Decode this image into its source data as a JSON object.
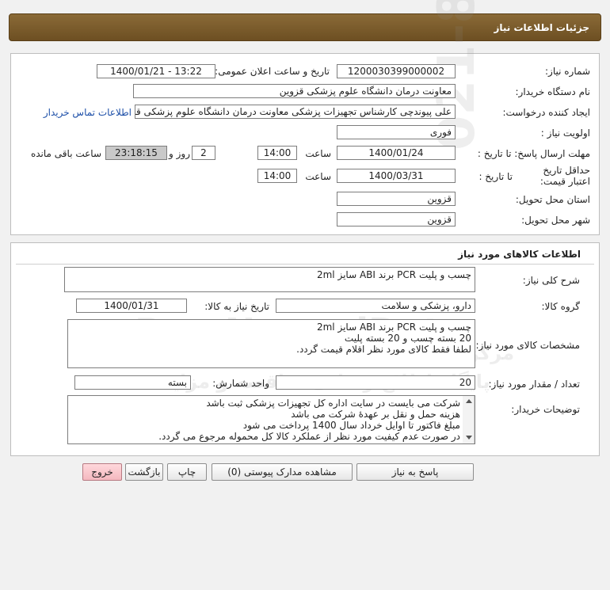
{
  "header": {
    "title": "جزئیات اطلاعات نیاز"
  },
  "info": {
    "need_number_label": "شماره نیاز:",
    "need_number": "1200030399000002",
    "announce_label": "تاریخ و ساعت اعلان عمومی:",
    "announce_value": "1400/01/21 - 13:22",
    "buyer_label": "نام دستگاه خریدار:",
    "buyer": "معاونت درمان دانشگاه علوم پزشکی قزوین",
    "creator_label": "ایجاد کننده درخواست:",
    "creator": "علی پیوندچی کارشناس تجهیزات پزشکی معاونت درمان دانشگاه علوم پزشکی قزوین",
    "contact_link": "اطلاعات تماس خریدار",
    "priority_label": "اولویت نیاز :",
    "priority": "فوری",
    "deadline_label": "مهلت ارسال پاسخ: تا تاریخ :",
    "deadline_date": "1400/01/24",
    "time_label": "ساعت",
    "deadline_time": "14:00",
    "days": "2",
    "days_label": "روز و",
    "remaining_timer": "23:18:15",
    "remaining_label": "ساعت باقی مانده",
    "validity_label": "حداقل تاریخ اعتبار قیمت:",
    "validity_until_label": "تا تاریخ :",
    "validity_date": "1400/03/31",
    "validity_time_label": "ساعت",
    "validity_time": "14:00",
    "province_label": "استان محل تحویل:",
    "province": "قزوین",
    "city_label": "شهر محل تحویل:",
    "city": "قزوین"
  },
  "goods": {
    "section_title": "اطلاعات کالاهای مورد نیاز",
    "summary_label": "شرح کلی نیاز:",
    "summary": "چسب و پلیت PCR برند ABI سایز 2ml",
    "group_label": "گروه کالا:",
    "group": "دارو، پزشکی و سلامت",
    "need_date_label": "تاریخ نیاز به کالا:",
    "need_date": "1400/01/31",
    "specs_label": "مشخصات کالای مورد نیاز:",
    "specs_lines": [
      "چسب و پلیت PCR برند ABI سایز 2ml",
      "20 بسته چسب و 20 بسته پلیت",
      "لطفا فقط کالای مورد نظر اقلام قیمت گردد."
    ],
    "qty_label": "تعداد / مقدار مورد نیاز:",
    "qty": "20",
    "unit_label": "واحد شمارش:",
    "unit": "بسته",
    "notes_label": "توضیحات خریدار:",
    "notes_lines": [
      "شرکت می بایست در سایت اداره کل تجهیزات پزشکی ثبت باشد",
      "هزینه حمل و نقل بر عهدهٔ شرکت می باشد",
      "مبلغ فاکتور تا اوایل خرداد سال 1400 پرداخت می شود",
      "در صورت عدم کیفیت مورد نظر از عملکرد کالا کل محموله مرجوع می گردد."
    ]
  },
  "buttons": {
    "reply": "پاسخ به نیاز",
    "attachments": "مشاهده مدارک پیوستی (0)",
    "print": "چاپ",
    "back": "بازگشت",
    "exit": "خروج"
  },
  "watermark": {
    "brand": "ParsNamadData",
    "persian": "مرکز فراهم آوری اطلاعات پارس نماد داده",
    "tagline": "پایگاه اطلاع رسانی مناقصه و مزایده",
    "phone": "021-88349670"
  },
  "icons": {
    "scroll_up": "scroll-up-arrow-icon",
    "scroll_down": "scroll-down-arrow-icon"
  }
}
